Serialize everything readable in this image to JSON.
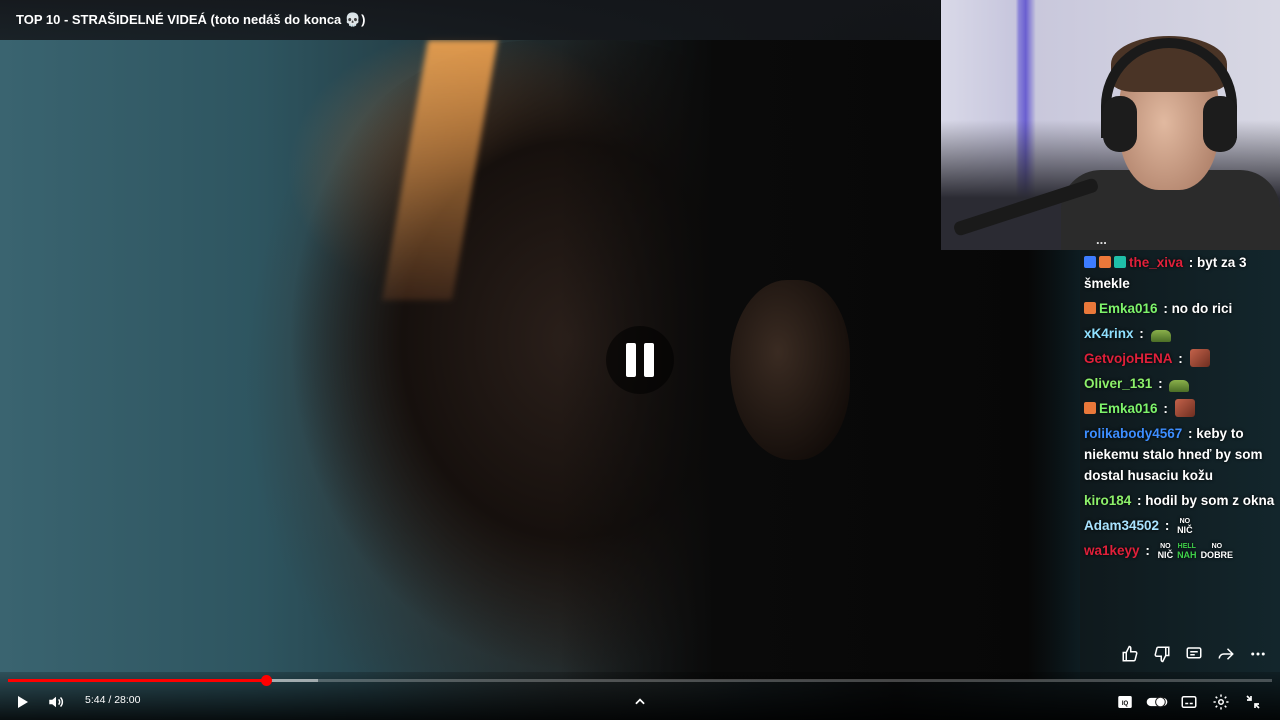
{
  "video": {
    "title": "TOP 10 - STRAŠIDELNÉ VIDEÁ (toto nedáš do konca 💀)",
    "current_time": "5:44",
    "duration": "28:00",
    "played_fraction": 0.204,
    "buffered_fraction": 0.245,
    "state": "paused",
    "accent_color": "#ff0000"
  },
  "chat": {
    "partial_top": "...",
    "messages": [
      {
        "badges": [
          "blue",
          "orange",
          "teal"
        ],
        "user": "the_xiva",
        "user_color": "#e0203a",
        "text": "byt za 3 šmekle",
        "emotes": []
      },
      {
        "badges": [
          "orange"
        ],
        "user": "Emka016",
        "user_color": "#7df36b",
        "text": "no do rici",
        "emotes": []
      },
      {
        "badges": [],
        "user": "xK4rinx",
        "user_color": "#8fe0ff",
        "text": "",
        "emotes": [
          "car"
        ]
      },
      {
        "badges": [],
        "user": "GetvojoHENA",
        "user_color": "#e0203a",
        "text": "",
        "emotes": [
          "square"
        ]
      },
      {
        "badges": [],
        "user": "Oliver_131",
        "user_color": "#8df06a",
        "text": "",
        "emotes": [
          "car"
        ]
      },
      {
        "badges": [
          "orange"
        ],
        "user": "Emka016",
        "user_color": "#7df36b",
        "text": "",
        "emotes": [
          "square"
        ]
      },
      {
        "badges": [],
        "user": "rolikabody4567",
        "user_color": "#3d8eff",
        "text": "keby to niekemu stalo hneď by som dostal husaciu kožu",
        "emotes": []
      },
      {
        "badges": [],
        "user": "kiro184",
        "user_color": "#8df06a",
        "text": "hodil by som z okna",
        "emotes": []
      },
      {
        "badges": [],
        "user": "Adam34502",
        "user_color": "#a9e3ff",
        "text": "",
        "emotes": [],
        "word_emotes": [
          [
            "NO",
            "NIČ"
          ]
        ]
      },
      {
        "badges": [],
        "user": "wa1keyy",
        "user_color": "#e0203a",
        "text": "",
        "emotes": [],
        "word_emotes": [
          [
            "NO",
            "NIČ"
          ],
          [
            "HELL",
            "NAH"
          ],
          [
            "NO",
            "DOBRE"
          ]
        ]
      }
    ]
  },
  "icons": {
    "play": "play-icon",
    "volume": "volume-icon",
    "chevron": "chevron-up-icon",
    "captions": "captions-icon",
    "autoplay": "autoplay-toggle-icon",
    "subtitles": "subtitles-icon",
    "settings": "settings-icon",
    "exit_fullscreen": "exit-fullscreen-icon",
    "like": "thumbs-up-icon",
    "dislike": "thumbs-down-icon",
    "comments": "comments-icon",
    "share": "share-icon",
    "more": "more-icon"
  }
}
